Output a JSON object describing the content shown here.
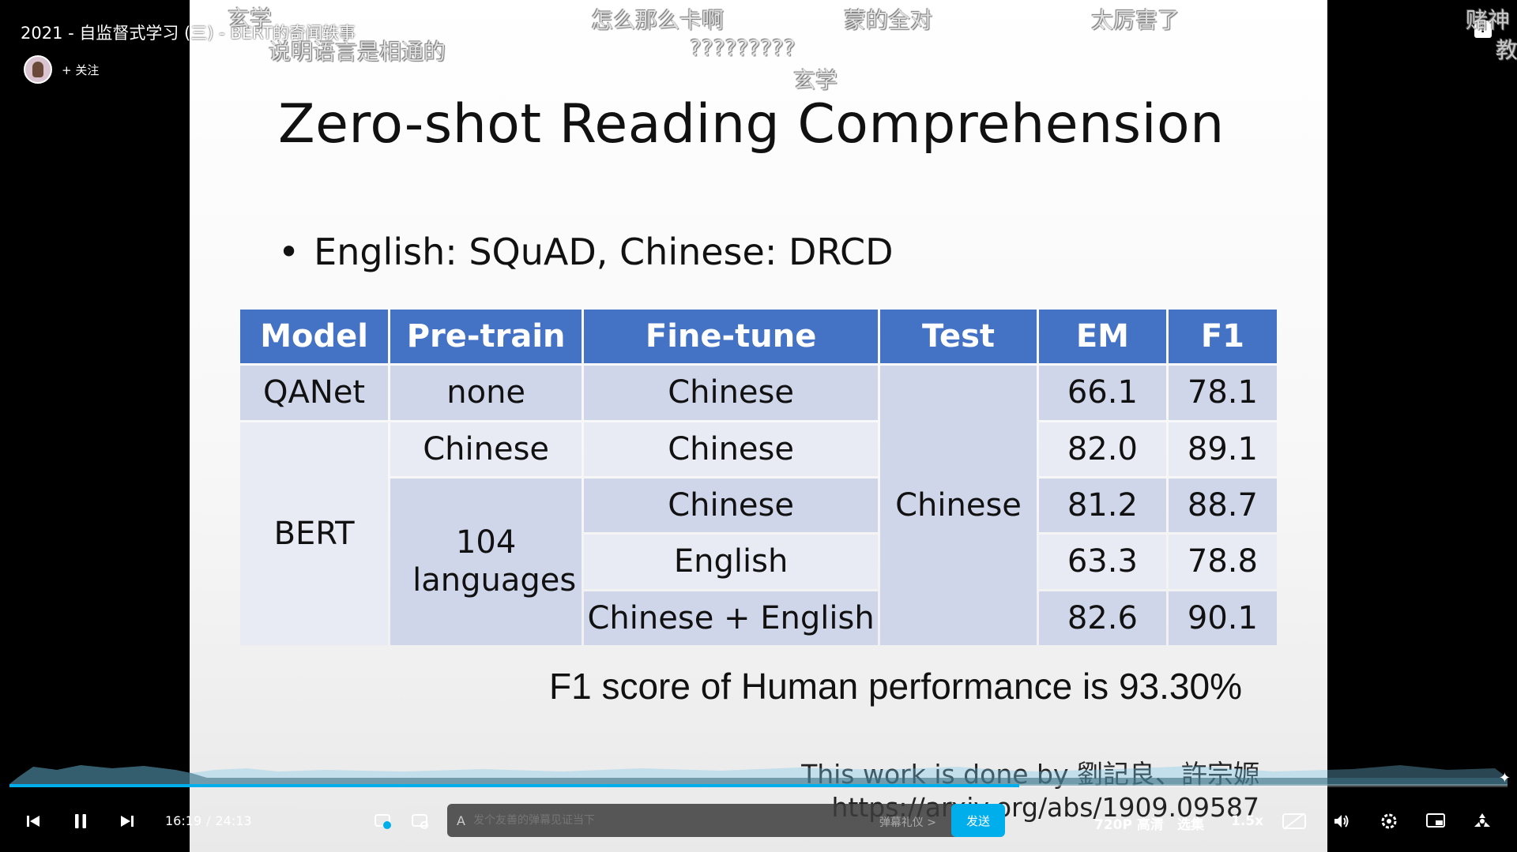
{
  "video": {
    "title": "2021 - 自监督式学习 (三) - BERT的奇闻轶事",
    "follow_label": "+ 关注"
  },
  "danmaku": [
    {
      "text": "玄学"
    },
    {
      "text": "说明语言是相通的"
    },
    {
      "text": "怎么那么卡啊"
    },
    {
      "text": "?????????"
    },
    {
      "text": "玄学"
    },
    {
      "text": "蒙的全对"
    },
    {
      "text": "太厉害了"
    },
    {
      "text": "赌神"
    },
    {
      "text": "教"
    }
  ],
  "slide": {
    "title": "Zero-shot Reading Comprehension",
    "bullet": "English: SQuAD, Chinese: DRCD",
    "table": {
      "headers": [
        "Model",
        "Pre-train",
        "Fine-tune",
        "Test",
        "EM",
        "F1"
      ],
      "model_qanet": "QANet",
      "model_bert": "BERT",
      "pretrain_none": "none",
      "pretrain_chinese": "Chinese",
      "pretrain_104": "104 languages",
      "test": "Chinese",
      "rows": [
        {
          "finetune": "Chinese",
          "em": "66.1",
          "f1": "78.1"
        },
        {
          "finetune": "Chinese",
          "em": "82.0",
          "f1": "89.1"
        },
        {
          "finetune": "Chinese",
          "em": "81.2",
          "f1": "88.7"
        },
        {
          "finetune": "English",
          "em": "63.3",
          "f1": "78.8"
        },
        {
          "finetune": "Chinese + English",
          "em": "82.6",
          "f1": "90.1"
        }
      ]
    },
    "human_note": "F1 score of Human performance is 93.30%",
    "credit_line1": "This work is done by 劉記良、許宗嫄",
    "credit_line2": "https://arxiv.org/abs/1909.09587"
  },
  "player": {
    "current_time": "16:19",
    "separator": "/",
    "total_time": "24:13",
    "progress": 0.674,
    "danmaku_placeholder": "发个友善的弹幕见证当下",
    "etiquette": "弹幕礼仪 >",
    "send_label": "发送",
    "quality": "720P 高清",
    "episodes": "选集",
    "speed": "1.5x",
    "accent": "#00aeec"
  }
}
